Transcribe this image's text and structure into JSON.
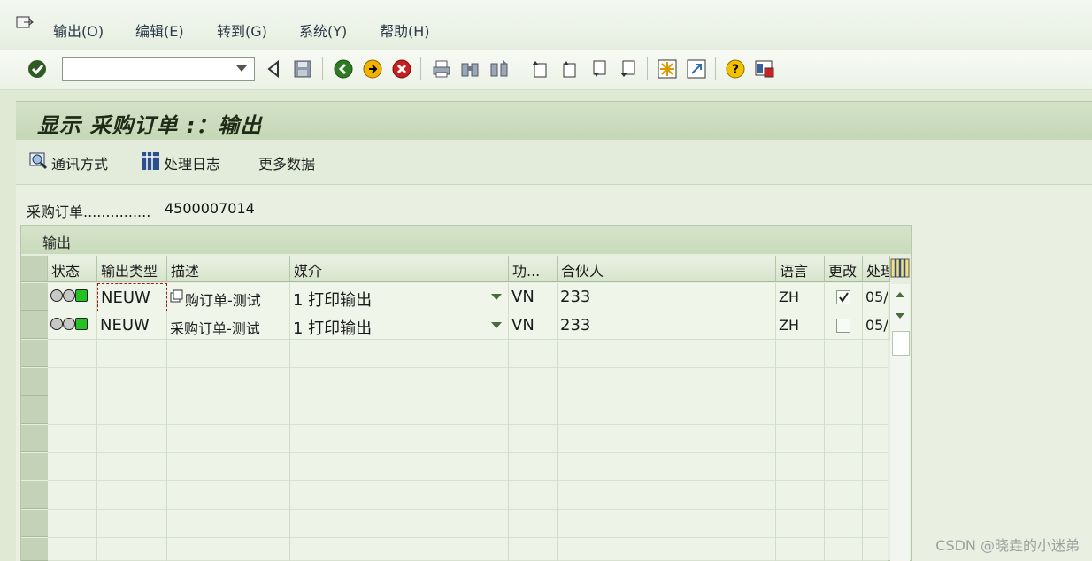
{
  "menu": {
    "items": [
      "输出(O)",
      "编辑(E)",
      "转到(G)",
      "系统(Y)",
      "帮助(H)"
    ]
  },
  "toolbar": {
    "command_field_value": "",
    "icons": [
      "enter-icon",
      "back-icon",
      "save-icon",
      "back-nav-icon",
      "exit-icon",
      "cancel-icon",
      "print-icon",
      "find-icon",
      "find-next-icon",
      "first-page-icon",
      "prev-page-icon",
      "next-page-icon",
      "last-page-icon",
      "new-session-icon",
      "shortcut-icon",
      "help-icon",
      "layout-icon"
    ]
  },
  "title": "显示 采购订单 :：输出",
  "app_toolbar": {
    "communication": "通讯方式",
    "processing_log": "处理日志",
    "more_data": "更多数据"
  },
  "po": {
    "label": "采购订单...............",
    "value": "4500007014"
  },
  "group": {
    "title": "输出"
  },
  "table": {
    "headers": [
      "状态",
      "输出类型",
      "描述",
      "媒介",
      "功...",
      "合伙人",
      "语言",
      "更改",
      "处理"
    ],
    "rows": [
      {
        "type": "NEUW",
        "desc": "购订单-测试",
        "medium": "1 打印输出",
        "func": "VN",
        "partner": "233",
        "lang": "ZH",
        "changed": true,
        "proc": "05/"
      },
      {
        "type": "NEUW",
        "desc": "采购订单-测试",
        "medium": "1 打印输出",
        "func": "VN",
        "partner": "233",
        "lang": "ZH",
        "changed": false,
        "proc": "05/"
      }
    ]
  },
  "watermark": "CSDN @晓垚的小迷弟"
}
